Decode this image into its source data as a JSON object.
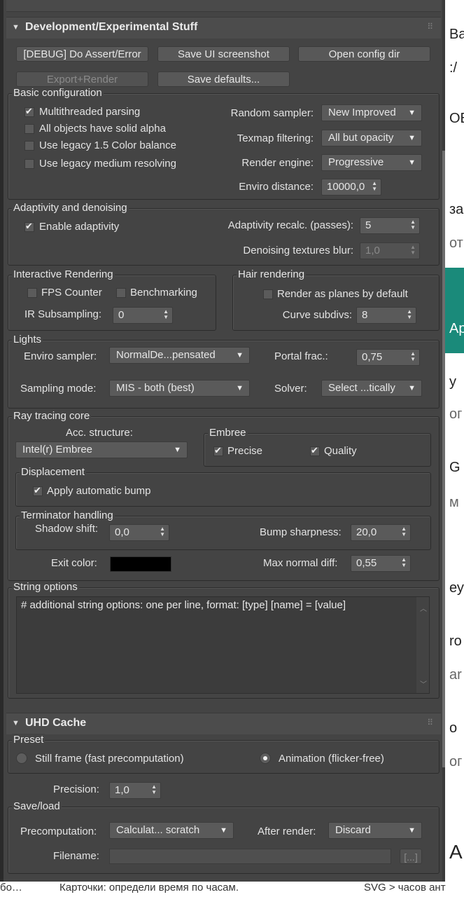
{
  "dev_section": {
    "title": "Development/Experimental Stuff",
    "buttons": {
      "debug_assert": "[DEBUG] Do Assert/Error",
      "save_ui_screenshot": "Save UI screenshot",
      "open_config_dir": "Open config dir",
      "export_render": "Export+Render",
      "save_defaults": "Save defaults..."
    },
    "basic": {
      "title": "Basic configuration",
      "multithreaded": "Multithreaded parsing",
      "solid_alpha": "All objects have solid alpha",
      "legacy_color": "Use legacy 1.5 Color balance",
      "legacy_medium": "Use legacy medium resolving",
      "random_sampler_label": "Random sampler:",
      "random_sampler_value": "New Improved",
      "texmap_label": "Texmap filtering:",
      "texmap_value": "All but opacity",
      "render_engine_label": "Render engine:",
      "render_engine_value": "Progressive",
      "enviro_distance_label": "Enviro distance:",
      "enviro_distance_value": "10000,0"
    },
    "adaptivity": {
      "title": "Adaptivity and denoising",
      "enable": "Enable adaptivity",
      "recalc_label": "Adaptivity recalc. (passes):",
      "recalc_value": "5",
      "blur_label": "Denoising textures blur:",
      "blur_value": "1,0"
    },
    "interactive": {
      "title": "Interactive Rendering",
      "fps": "FPS Counter",
      "bench": "Benchmarking",
      "ir_label": "IR Subsampling:",
      "ir_value": "0"
    },
    "hair": {
      "title": "Hair rendering",
      "planes": "Render as planes by default",
      "curve_label": "Curve subdivs:",
      "curve_value": "8"
    },
    "lights": {
      "title": "Lights",
      "enviro_sampler_label": "Enviro sampler:",
      "enviro_sampler_value": "NormalDe...pensated",
      "portal_label": "Portal frac.:",
      "portal_value": "0,75",
      "sampling_label": "Sampling mode:",
      "sampling_value": "MIS - both (best)",
      "solver_label": "Solver:",
      "solver_value": "Select ...tically"
    },
    "raytracing": {
      "title": "Ray tracing core",
      "acc_label": "Acc. structure:",
      "acc_value": "Intel(r) Embree",
      "embree_title": "Embree",
      "precise": "Precise",
      "quality": "Quality",
      "displacement_title": "Displacement",
      "auto_bump": "Apply automatic bump",
      "terminator_title": "Terminator handling",
      "shadow_label": "Shadow shift:",
      "shadow_value": "0,0",
      "bump_label": "Bump sharpness:",
      "bump_value": "20,0",
      "exit_label": "Exit color:",
      "exit_color": "#000000",
      "max_normal_label": "Max normal diff:",
      "max_normal_value": "0,55"
    },
    "string_options": {
      "title": "String options",
      "text": "# additional string options: one per line, format: [type] [name] = [value]"
    }
  },
  "uhd_section": {
    "title": "UHD Cache",
    "preset_title": "Preset",
    "still": "Still frame (fast precomputation)",
    "animation": "Animation (flicker-free)",
    "precision_label": "Precision:",
    "precision_value": "1,0",
    "saveload_title": "Save/load",
    "precomp_label": "Precomputation:",
    "precomp_value": "Calculat... scratch",
    "after_label": "After render:",
    "after_value": "Discard",
    "filename_label": "Filename:",
    "browse": "[...]"
  },
  "background": {
    "right_texts": [
      "Ва",
      ":/",
      "ОВ",
      "за",
      "от",
      "Ap",
      "у",
      "ог",
      "G",
      "м",
      "еу",
      "ro",
      "ar",
      "o",
      "ог",
      "AI"
    ],
    "taskbar": [
      "бо…",
      "Карточки: определи время по часам.",
      "SVG > часов ант"
    ]
  }
}
